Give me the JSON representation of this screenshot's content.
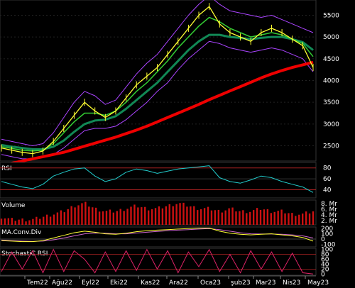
{
  "chart_data": {
    "type": "line",
    "dates": [
      "Tem22",
      "Ağu22",
      "Eyl22",
      "Eki22",
      "Kas22",
      "Ara22",
      "Oca23",
      "Şub23",
      "Mar23",
      "Nis23",
      "May23"
    ],
    "date_labels_shown": [
      "Tem22",
      "Ağu22",
      "Eyl22",
      "Eki22",
      "Kas22",
      "Ara22",
      "Oca23",
      "Şub23",
      "Mar23",
      "Nis23",
      "May23"
    ],
    "date_labels_visible": [
      "Tem22",
      "Ağu22",
      "Eyl22",
      "Eki22",
      "Kas22",
      "Ara22",
      "Oca23",
      "şub23",
      "Mar23",
      "Nis23",
      "May23"
    ],
    "price_panel": {
      "yticks": [
        "5500",
        "5000",
        "4500",
        "4000",
        "3500",
        "3000",
        "2500"
      ],
      "ytick_values": [
        5500,
        5000,
        4500,
        4000,
        3500,
        3000,
        2500
      ],
      "ylim": [
        2150,
        5850
      ],
      "close": [
        2450,
        2400,
        2350,
        2320,
        2380,
        2600,
        2900,
        3200,
        3500,
        3300,
        3150,
        3300,
        3600,
        3900,
        4100,
        4300,
        4600,
        4900,
        5200,
        5500,
        5700,
        5300,
        5100,
        5000,
        4900,
        5100,
        5200,
        5100,
        4950,
        4800,
        4300
      ],
      "ma_fast": [
        2480,
        2440,
        2400,
        2380,
        2400,
        2550,
        2800,
        3050,
        3250,
        3250,
        3200,
        3300,
        3500,
        3750,
        3950,
        4200,
        4450,
        4750,
        5000,
        5250,
        5450,
        5350,
        5200,
        5100,
        5000,
        5050,
        5100,
        5050,
        4950,
        4850,
        4550
      ],
      "ma_mid": [
        2520,
        2480,
        2450,
        2420,
        2420,
        2480,
        2620,
        2820,
        3000,
        3080,
        3100,
        3180,
        3350,
        3550,
        3750,
        3950,
        4200,
        4450,
        4700,
        4900,
        5050,
        5050,
        5000,
        4980,
        4950,
        4980,
        5000,
        5000,
        4950,
        4880,
        4700
      ],
      "ma_long": [
        2050,
        2100,
        2150,
        2200,
        2250,
        2300,
        2350,
        2420,
        2490,
        2560,
        2630,
        2700,
        2780,
        2860,
        2950,
        3050,
        3150,
        3250,
        3350,
        3450,
        3560,
        3660,
        3760,
        3860,
        3960,
        4060,
        4150,
        4230,
        4300,
        4360,
        4420
      ],
      "bb_upper": [
        2650,
        2600,
        2550,
        2500,
        2550,
        2800,
        3150,
        3500,
        3750,
        3650,
        3450,
        3550,
        3850,
        4150,
        4400,
        4600,
        4900,
        5200,
        5500,
        5750,
        5950,
        5750,
        5600,
        5550,
        5500,
        5450,
        5500,
        5400,
        5300,
        5200,
        5100
      ],
      "bb_lower": [
        2300,
        2250,
        2200,
        2200,
        2250,
        2300,
        2450,
        2650,
        2850,
        2900,
        2900,
        2950,
        3100,
        3300,
        3500,
        3750,
        3950,
        4250,
        4500,
        4700,
        4900,
        4850,
        4750,
        4700,
        4650,
        4700,
        4750,
        4700,
        4600,
        4500,
        4200
      ],
      "colors": {
        "close": "#ffff33",
        "ma_fast": "#33cc33",
        "ma_mid": "#118855",
        "ma_long": "#ee0000",
        "bb_upper": "#aa44ff",
        "bb_lower": "#aa44ff",
        "envelope": "#3355ff"
      }
    },
    "rsi_panel": {
      "label": "RSI",
      "yticks": [
        "80",
        "60",
        "40"
      ],
      "ytick_values": [
        80,
        60,
        40
      ],
      "ylim": [
        25,
        90
      ],
      "values": [
        55,
        50,
        45,
        42,
        50,
        65,
        72,
        78,
        80,
        65,
        55,
        60,
        72,
        78,
        75,
        70,
        74,
        78,
        80,
        82,
        84,
        62,
        55,
        52,
        58,
        65,
        62,
        55,
        50,
        45,
        35
      ],
      "color": "#22cccc"
    },
    "volume_panel": {
      "label": "Volume",
      "yticks": [
        "8. Mr",
        "6. Mr",
        "4. Mr",
        "2. Mr"
      ],
      "values": [
        3,
        2,
        2,
        2,
        3,
        4,
        5,
        7,
        8,
        6,
        5,
        5,
        6,
        7,
        6,
        6,
        7,
        8,
        7,
        6,
        6,
        5,
        6,
        5,
        5,
        6,
        5,
        5,
        4,
        4,
        5
      ],
      "color": "#cc1111"
    },
    "macd_panel": {
      "label": "MA.Conv.Div",
      "yticks": [
        "200",
        "100",
        "0",
        "-100"
      ],
      "ytick_values": [
        200,
        100,
        0,
        -100
      ],
      "ylim": [
        -150,
        230
      ],
      "macd": [
        -30,
        -40,
        -50,
        -50,
        -30,
        20,
        70,
        120,
        150,
        130,
        100,
        90,
        110,
        140,
        160,
        170,
        180,
        190,
        200,
        210,
        210,
        150,
        110,
        90,
        80,
        90,
        100,
        80,
        60,
        30,
        -40
      ],
      "signal": [
        -20,
        -30,
        -40,
        -45,
        -40,
        -15,
        20,
        60,
        100,
        115,
        110,
        100,
        100,
        115,
        130,
        145,
        160,
        170,
        180,
        190,
        200,
        180,
        150,
        120,
        100,
        95,
        95,
        90,
        80,
        60,
        20
      ],
      "colors": {
        "macd": "#ffff33",
        "signal": "#cc66cc"
      }
    },
    "stoch_panel": {
      "label": "StochastiC RSI",
      "yticks": [
        "100",
        "80",
        "60",
        "40",
        "20",
        "0"
      ],
      "ytick_values": [
        100,
        80,
        60,
        40,
        20,
        0
      ],
      "ylim": [
        -5,
        105
      ],
      "values": [
        10,
        90,
        20,
        95,
        5,
        100,
        10,
        95,
        60,
        5,
        90,
        10,
        95,
        15,
        100,
        20,
        95,
        5,
        90,
        30,
        100,
        10,
        80,
        5,
        95,
        20,
        90,
        10,
        85,
        5,
        0
      ],
      "color": "#dd2266"
    }
  }
}
